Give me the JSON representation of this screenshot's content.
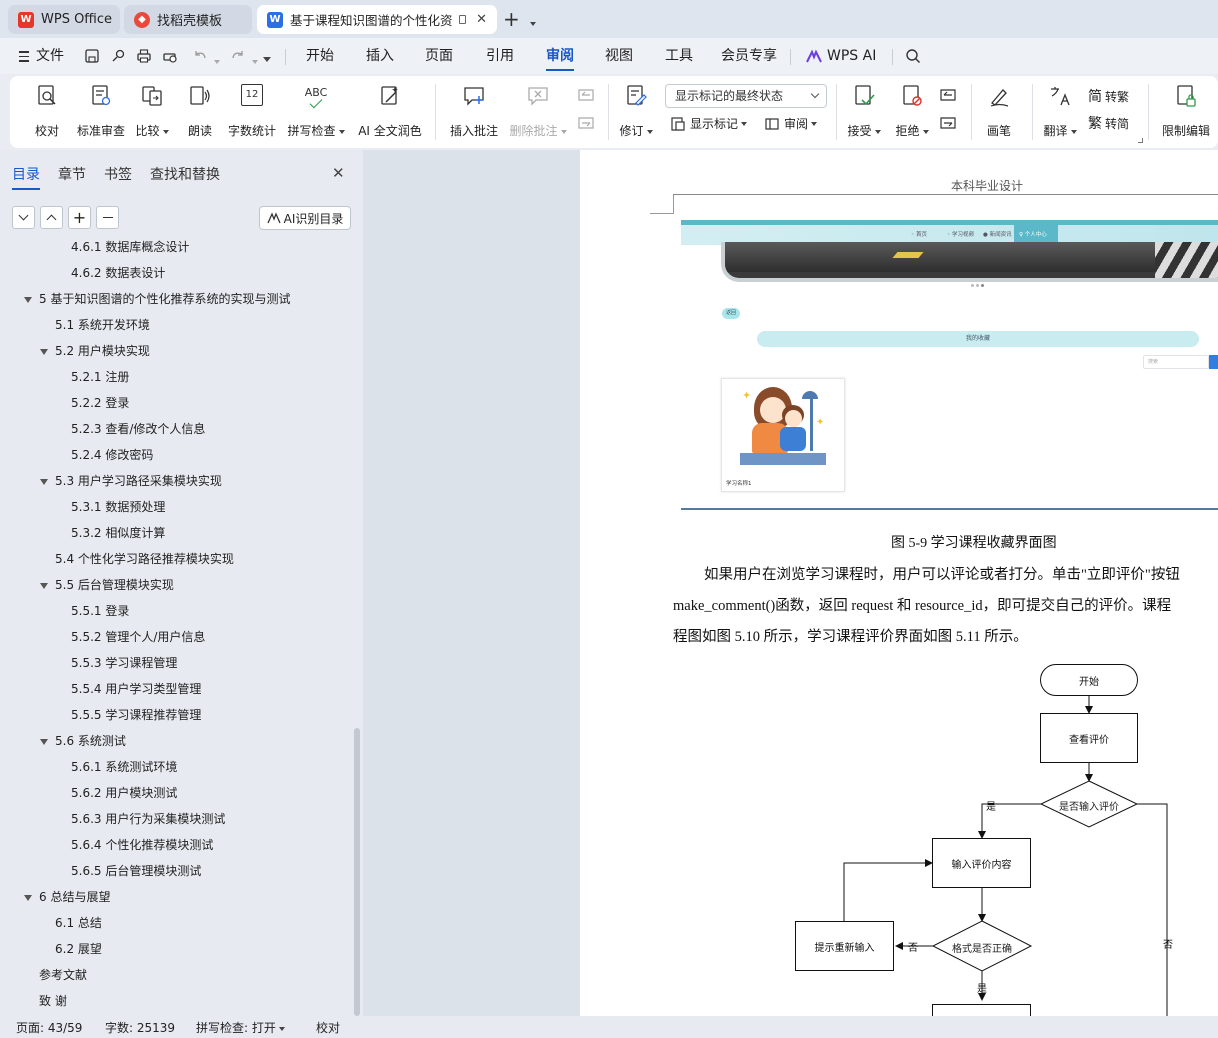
{
  "tabs": [
    {
      "label": "WPS Office",
      "active": false
    },
    {
      "label": "找稻壳模板",
      "active": false
    },
    {
      "label": "基于课程知识图谱的个性化资",
      "active": true
    }
  ],
  "menus": [
    "文件",
    "开始",
    "插入",
    "页面",
    "引用",
    "审阅",
    "视图",
    "工具",
    "会员专享",
    "WPS AI"
  ],
  "active_menu": "审阅",
  "ribbon": {
    "proofread": "校对",
    "standard_review": "标准审查",
    "compare": "比较",
    "read_aloud": "朗读",
    "word_count": "字数统计",
    "spell_check": "拼写检查",
    "ai_polish": "AI 全文润色",
    "insert_comment": "插入批注",
    "delete_comment": "删除批注",
    "revise": "修订",
    "markup_select": "显示标记的最终状态",
    "show_markup": "显示标记",
    "review_pane": "审阅",
    "accept": "接受",
    "reject": "拒绝",
    "pen": "画笔",
    "translate": "翻译",
    "trad": "转繁",
    "simp": "转简",
    "restrict": "限制编辑",
    "word_count_icon_text": "12",
    "spell_icon_text": "ABC"
  },
  "nav": {
    "tabs": [
      "目录",
      "章节",
      "书签",
      "查找和替换"
    ],
    "ai_toc": "AI识别目录",
    "toc": [
      {
        "text": "4.6.1  数据库概念设计",
        "level": 3,
        "expanded": null
      },
      {
        "text": "4.6.2  数据表设计",
        "level": 3,
        "expanded": null
      },
      {
        "text": "5  基于知识图谱的个性化推荐系统的实现与测试",
        "level": 1,
        "expanded": true
      },
      {
        "text": "5.1  系统开发环境",
        "level": 2,
        "expanded": null
      },
      {
        "text": "5.2  用户模块实现",
        "level": 2,
        "expanded": true
      },
      {
        "text": "5.2.1  注册",
        "level": 3,
        "expanded": null
      },
      {
        "text": "5.2.2  登录",
        "level": 3,
        "expanded": null
      },
      {
        "text": "5.2.3  查看/修改个人信息",
        "level": 3,
        "expanded": null
      },
      {
        "text": "5.2.4  修改密码",
        "level": 3,
        "expanded": null
      },
      {
        "text": "5.3  用户学习路径采集模块实现",
        "level": 2,
        "expanded": true
      },
      {
        "text": "5.3.1  数据预处理",
        "level": 3,
        "expanded": null
      },
      {
        "text": "5.3.2  相似度计算",
        "level": 3,
        "expanded": null
      },
      {
        "text": "5.4  个性化学习路径推荐模块实现",
        "level": 2,
        "expanded": null
      },
      {
        "text": "5.5  后台管理模块实现",
        "level": 2,
        "expanded": true
      },
      {
        "text": "5.5.1  登录",
        "level": 3,
        "expanded": null
      },
      {
        "text": "5.5.2  管理个人/用户信息",
        "level": 3,
        "expanded": null
      },
      {
        "text": "5.5.3  学习课程管理",
        "level": 3,
        "expanded": null
      },
      {
        "text": "5.5.4  用户学习类型管理",
        "level": 3,
        "expanded": null
      },
      {
        "text": "5.5.5  学习课程推荐管理",
        "level": 3,
        "expanded": null
      },
      {
        "text": "5.6 系统测试",
        "level": 2,
        "expanded": true
      },
      {
        "text": "5.6.1  系统测试环境",
        "level": 3,
        "expanded": null
      },
      {
        "text": "5.6.2  用户模块测试",
        "level": 3,
        "expanded": null
      },
      {
        "text": "5.6.3  用户行为采集模块测试",
        "level": 3,
        "expanded": null
      },
      {
        "text": "5.6.4  个性化推荐模块测试",
        "level": 3,
        "expanded": null
      },
      {
        "text": "5.6.5  后台管理模块测试",
        "level": 3,
        "expanded": null
      },
      {
        "text": "6  总结与展望",
        "level": 1,
        "expanded": true
      },
      {
        "text": "6.1  总结",
        "level": 2,
        "expanded": null
      },
      {
        "text": "6.2  展望",
        "level": 2,
        "expanded": null
      },
      {
        "text": "参考文献",
        "level": 1,
        "expanded": null
      },
      {
        "text": "致      谢",
        "level": 1,
        "expanded": null
      }
    ]
  },
  "doc": {
    "header": "本科毕业设计",
    "screenshot": {
      "nav_items": [
        "首页",
        "学习视频",
        "新闻资讯",
        "个人中心"
      ],
      "back": "返回",
      "banner": "我的收藏",
      "search_placeholder": "搜索",
      "card_label": "学习名称1"
    },
    "caption": "图 5-9 学习课程收藏界面图",
    "para1": "如果用户在浏览学习课程时，用户可以评论或者打分。单击\"立即评价\"按钮",
    "para2": "make_comment()函数，返回 request 和  resource_id，即可提交自己的评价。课程",
    "para3": "程图如图 5.10 所示，学习课程评价界面如图 5.11 所示。",
    "flow": {
      "start": "开始",
      "view": "查看评价",
      "decide": "是否输入评价",
      "input": "输入评价内容",
      "check": "格式是否正确",
      "prompt": "提示重新输入",
      "yes": "是",
      "no": "否",
      "yes2": "是",
      "no2": "否"
    }
  },
  "status": {
    "page": "页面: 43/59",
    "words": "字数: 25139",
    "spell": "拼写检查: 打开",
    "proof": "校对"
  }
}
